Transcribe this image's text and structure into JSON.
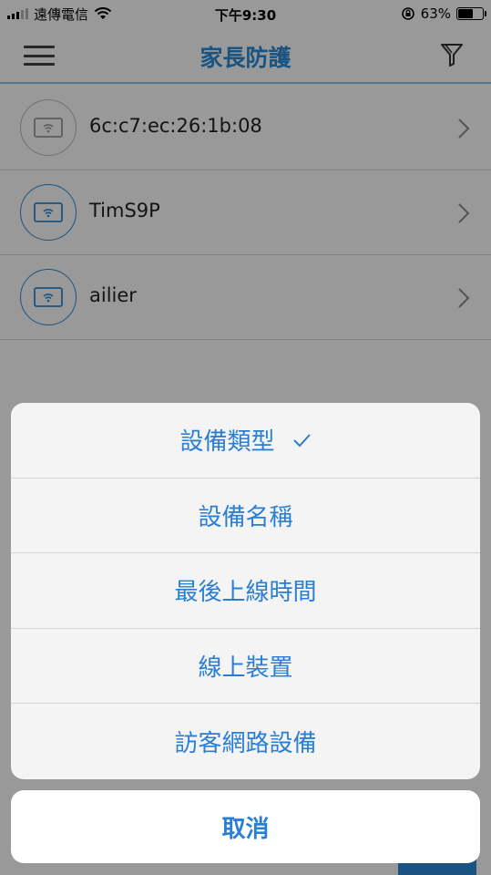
{
  "status_bar": {
    "carrier": "遠傳電信",
    "time": "下午9:30",
    "battery_percent": "63%",
    "battery_level": 0.63
  },
  "header": {
    "title": "家長防護"
  },
  "devices": [
    {
      "name": "6c:c7:ec:26:1b:08",
      "status": "offline"
    },
    {
      "name": "TimS9P",
      "status": "online"
    },
    {
      "name": "ailier",
      "status": "online"
    }
  ],
  "sort_sheet": {
    "options": [
      {
        "label": "設備類型",
        "selected": true
      },
      {
        "label": "設備名稱",
        "selected": false
      },
      {
        "label": "最後上線時間",
        "selected": false
      },
      {
        "label": "線上裝置",
        "selected": false
      },
      {
        "label": "訪客網路設備",
        "selected": false
      }
    ],
    "cancel_label": "取消"
  },
  "colors": {
    "accent": "#2a8bd8",
    "sheet_text": "#2a7fd4",
    "offline_ring": "#b9b9b9"
  }
}
